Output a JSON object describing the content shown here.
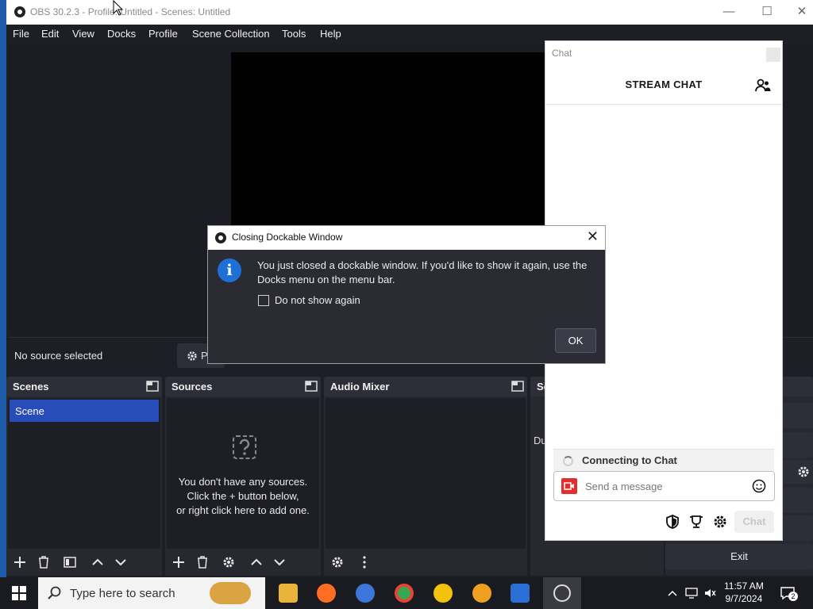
{
  "window": {
    "title": "OBS 30.2.3 - Profile: Untitled - Scenes: Untitled",
    "minimize": "—",
    "maximize": "☐",
    "close": "✕"
  },
  "menu": [
    "File",
    "Edit",
    "View",
    "Docks",
    "Profile",
    "Scene Collection",
    "Tools",
    "Help"
  ],
  "source_bar": {
    "no_source": "No source selected",
    "properties_label": "Pr"
  },
  "docks": {
    "scenes": {
      "title": "Scenes",
      "items": [
        "Scene"
      ]
    },
    "sources": {
      "title": "Sources",
      "empty_line1": "You don't have any sources.",
      "empty_line2": "Click the + button below,",
      "empty_line3": "or right click here to add one."
    },
    "audio_mixer": {
      "title": "Audio Mixer"
    },
    "transitions": {
      "title": "Sc",
      "partial_label": "Du"
    }
  },
  "chat": {
    "window_title": "Chat",
    "header": "STREAM CHAT",
    "connecting": "Connecting to Chat",
    "placeholder": "Send a message",
    "send_label": "Chat"
  },
  "dialog": {
    "title": "Closing Dockable Window",
    "message": "You just closed a dockable window. If you'd like to show it again, use the Docks menu on the menu bar.",
    "checkbox_label": "Do not show again",
    "checkbox_checked": false,
    "ok_label": "OK"
  },
  "controls": {
    "exit_label": "Exit"
  },
  "taskbar": {
    "search_placeholder": "Type here to search",
    "time": "11:57 AM",
    "date": "9/7/2024",
    "notification_count": "2"
  }
}
